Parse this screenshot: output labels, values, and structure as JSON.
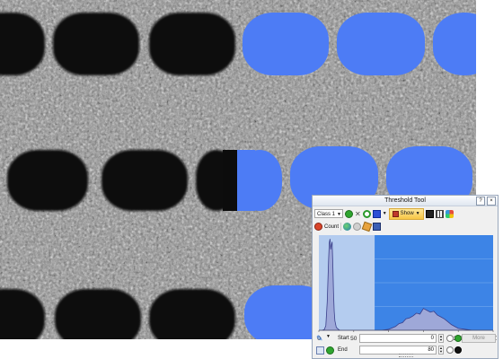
{
  "window": {
    "title": "Threshold Tool",
    "help_label": "?",
    "close_label": "×"
  },
  "toolbar": {
    "class_select_value": "Class 1",
    "show_label": "Show",
    "count_label": "Count"
  },
  "controls": {
    "start_label": "Start",
    "start_value": "0",
    "end_label": "End",
    "end_value": "80",
    "more_label": "More"
  },
  "colors": {
    "threshold_overlay": "#4d7cf5",
    "pore_dark": "#0c0c0c",
    "histogram_fill": "#9ea8d8",
    "histogram_stroke": "#3a3f8a",
    "selection_band": "#b4ccef",
    "chart_background": "#3d84e6"
  },
  "icons": [
    "green-circle-icon",
    "close-x-icon",
    "refresh-icon",
    "color-square-icon",
    "show-icon",
    "picture-icon",
    "ruler-icon",
    "palette-icon",
    "count-icon",
    "globe-icon",
    "eraser-icon",
    "save-icon",
    "eyedropper-icon",
    "invert-icon"
  ],
  "chart_data": {
    "type": "area",
    "xlim": [
      0,
      250
    ],
    "xticks": [
      0,
      50,
      100,
      150,
      200,
      250
    ],
    "selection": [
      0,
      80
    ],
    "x": [
      0,
      5,
      8,
      10,
      12,
      14,
      15,
      16,
      17,
      18,
      19,
      20,
      21,
      22,
      23,
      25,
      28,
      30,
      40,
      50,
      60,
      70,
      80,
      90,
      100,
      110,
      115,
      120,
      125,
      130,
      135,
      140,
      145,
      150,
      155,
      160,
      165,
      170,
      175,
      180,
      185,
      190,
      195,
      200,
      210,
      220,
      230,
      240,
      250
    ],
    "y": [
      0,
      0,
      0.01,
      0.05,
      0.3,
      0.75,
      0.92,
      0.96,
      0.85,
      0.9,
      0.93,
      0.7,
      0.4,
      0.2,
      0.1,
      0.03,
      0.01,
      0,
      0,
      0,
      0,
      0,
      0,
      0,
      0.01,
      0.04,
      0.07,
      0.08,
      0.12,
      0.13,
      0.15,
      0.18,
      0.17,
      0.23,
      0.21,
      0.19,
      0.2,
      0.16,
      0.14,
      0.12,
      0.09,
      0.06,
      0.04,
      0.02,
      0.01,
      0,
      0,
      0,
      0
    ]
  }
}
